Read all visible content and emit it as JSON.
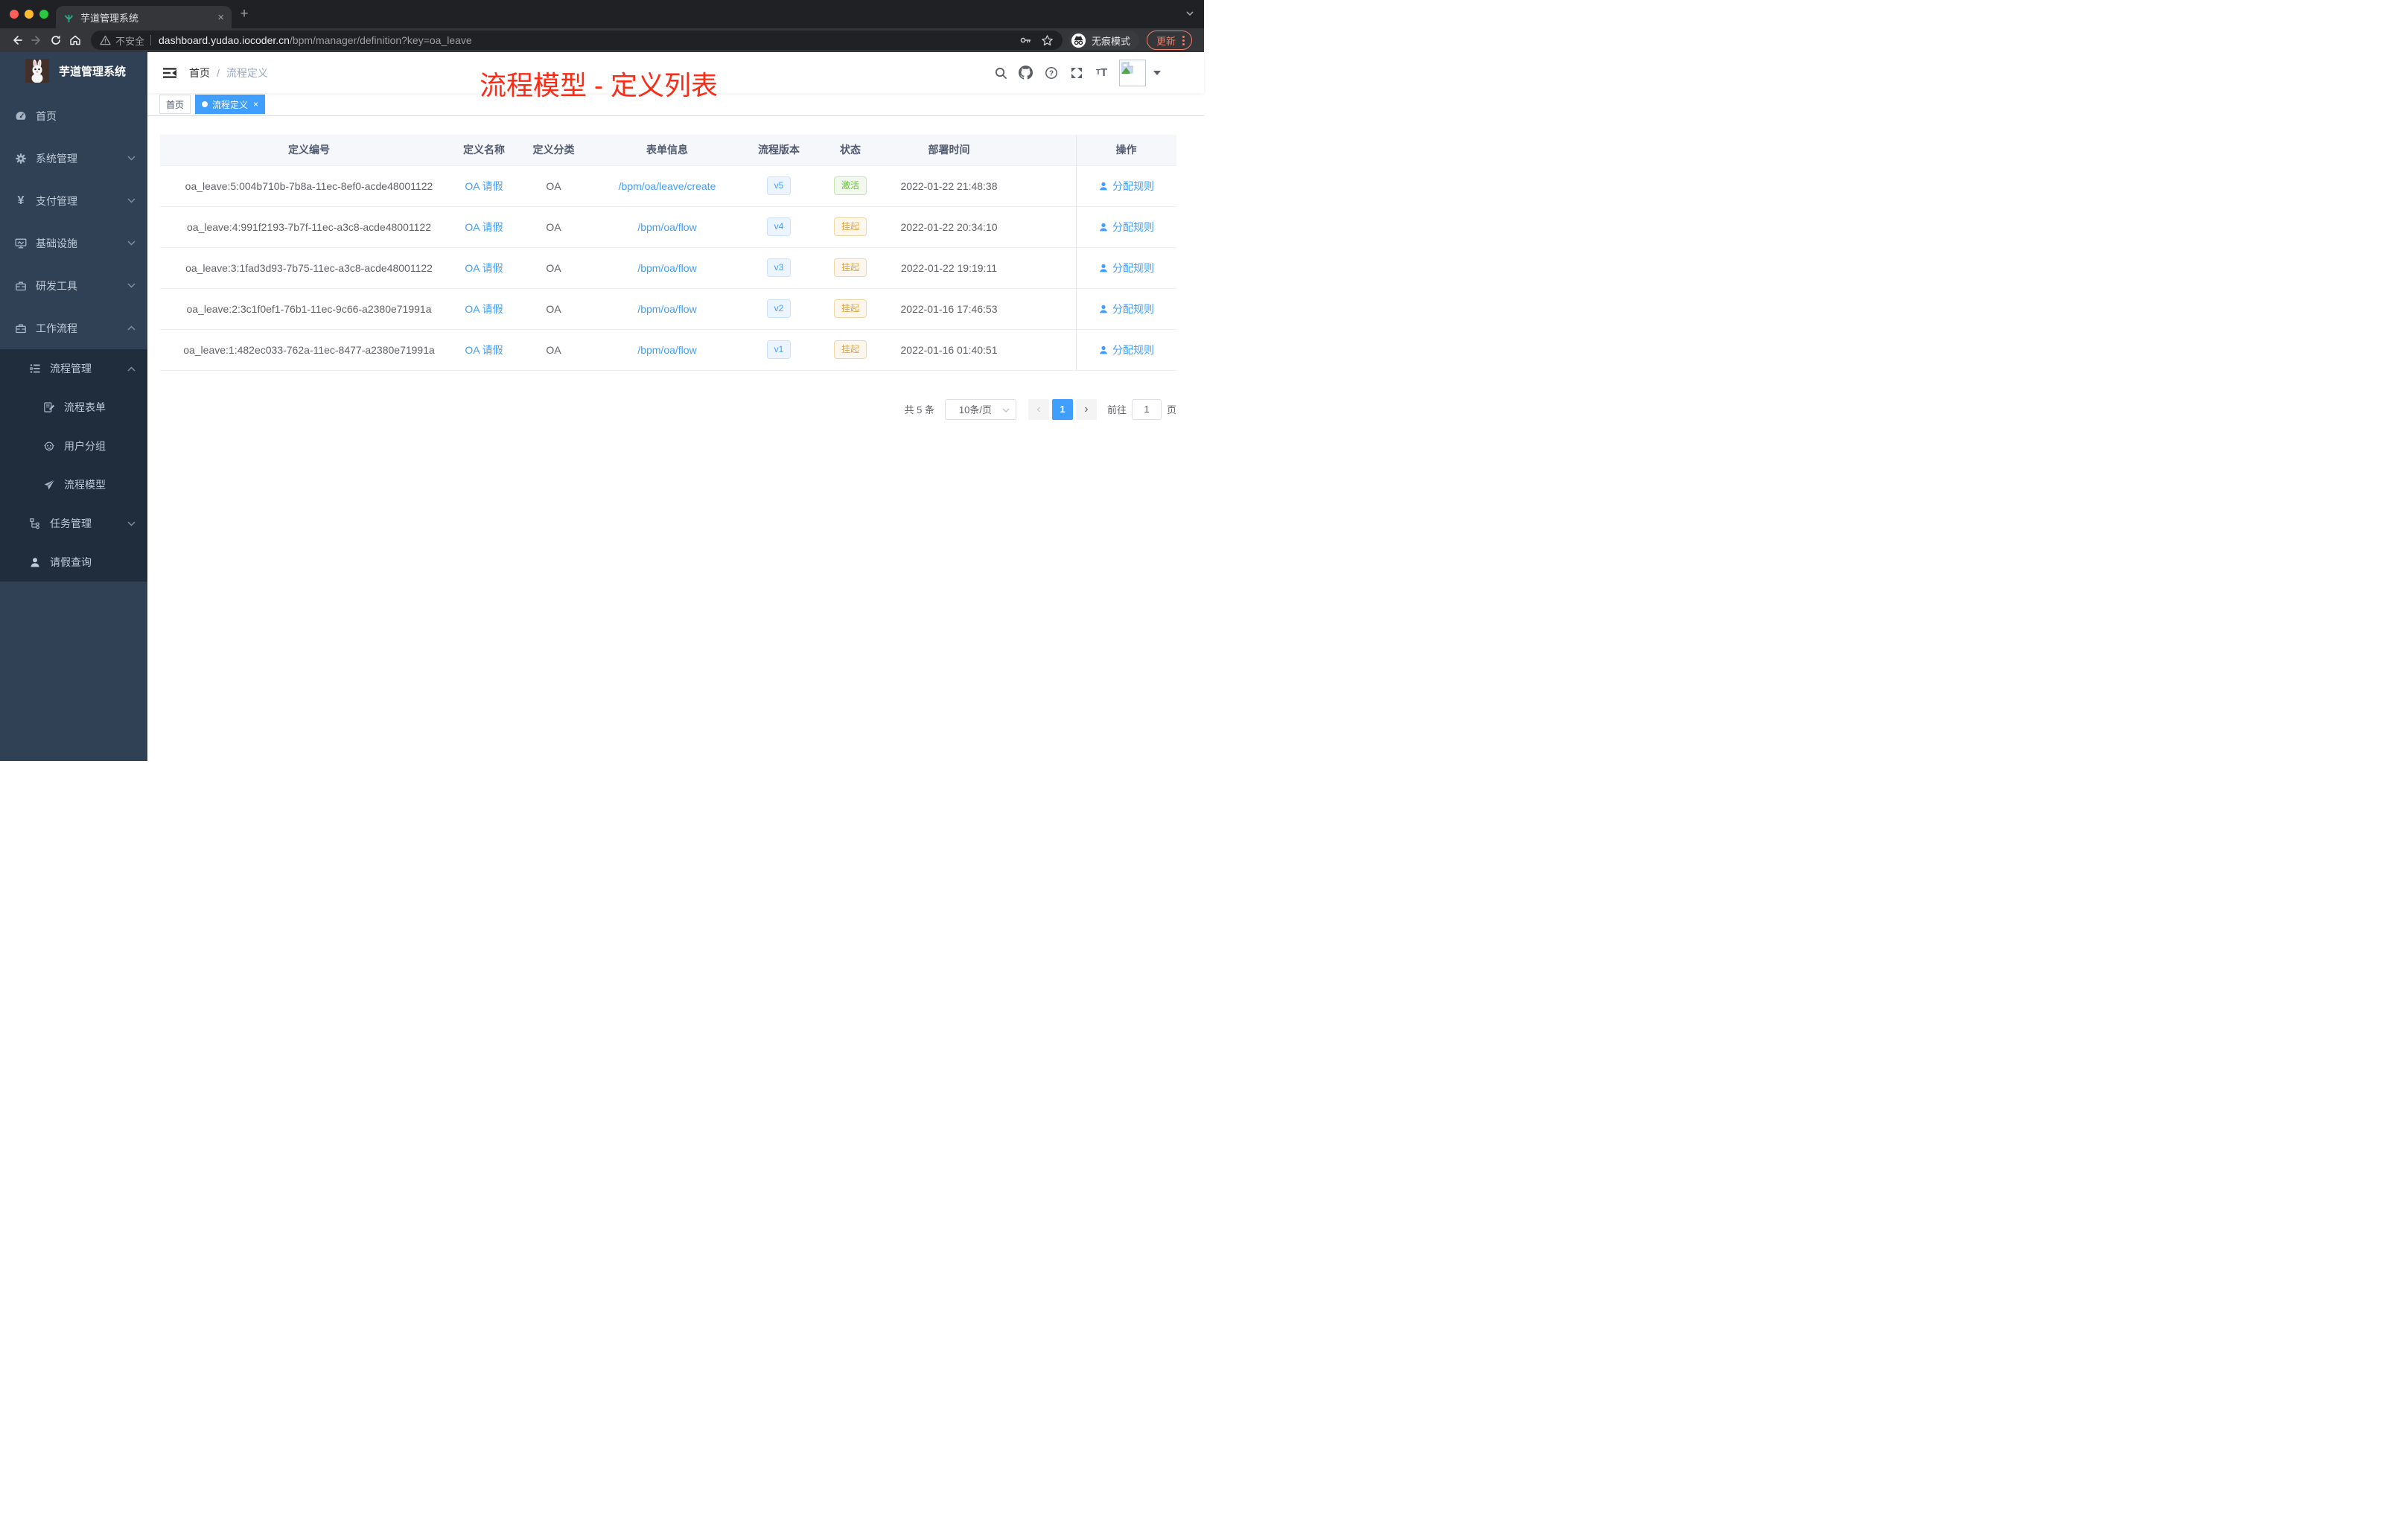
{
  "browser": {
    "tab": {
      "title": "芋道管理系统",
      "close": "×",
      "new_tab": "+"
    },
    "toolbar": {
      "security_label": "不安全",
      "url_host": "dashboard.yudao.iocoder.cn",
      "url_path": "/bpm/manager/definition?key=oa_leave",
      "incognito_label": "无痕模式",
      "update_label": "更新"
    }
  },
  "sidebar": {
    "logo_title": "芋道管理系统",
    "items": [
      {
        "label": "首页"
      },
      {
        "label": "系统管理"
      },
      {
        "label": "支付管理"
      },
      {
        "label": "基础设施"
      },
      {
        "label": "研发工具"
      },
      {
        "label": "工作流程"
      }
    ],
    "sub_items": [
      {
        "label": "流程管理"
      },
      {
        "label": "流程表单"
      },
      {
        "label": "用户分组"
      },
      {
        "label": "流程模型"
      },
      {
        "label": "任务管理"
      },
      {
        "label": "请假查询"
      }
    ]
  },
  "navbar": {
    "breadcrumb": {
      "home": "首页",
      "separator": "/",
      "current": "流程定义"
    },
    "annotation": "流程模型 - 定义列表"
  },
  "tags": {
    "home": "首页",
    "active": "流程定义",
    "close": "×"
  },
  "table": {
    "headers": [
      "定义编号",
      "定义名称",
      "定义分类",
      "表单信息",
      "流程版本",
      "状态",
      "部署时间",
      "操作"
    ],
    "action_label": "分配规则",
    "rows": [
      {
        "id": "oa_leave:5:004b710b-7b8a-11ec-8ef0-acde48001122",
        "name": "OA 请假",
        "category": "OA",
        "form": "/bpm/oa/leave/create",
        "version": "v5",
        "status": "激活",
        "time": "2022-01-22 21:48:38"
      },
      {
        "id": "oa_leave:4:991f2193-7b7f-11ec-a3c8-acde48001122",
        "name": "OA 请假",
        "category": "OA",
        "form": "/bpm/oa/flow",
        "version": "v4",
        "status": "挂起",
        "time": "2022-01-22 20:34:10"
      },
      {
        "id": "oa_leave:3:1fad3d93-7b75-11ec-a3c8-acde48001122",
        "name": "OA 请假",
        "category": "OA",
        "form": "/bpm/oa/flow",
        "version": "v3",
        "status": "挂起",
        "time": "2022-01-22 19:19:11"
      },
      {
        "id": "oa_leave:2:3c1f0ef1-76b1-11ec-9c66-a2380e71991a",
        "name": "OA 请假",
        "category": "OA",
        "form": "/bpm/oa/flow",
        "version": "v2",
        "status": "挂起",
        "time": "2022-01-16 17:46:53"
      },
      {
        "id": "oa_leave:1:482ec033-762a-11ec-8477-a2380e71991a",
        "name": "OA 请假",
        "category": "OA",
        "form": "/bpm/oa/flow",
        "version": "v1",
        "status": "挂起",
        "time": "2022-01-16 01:40:51"
      }
    ]
  },
  "pagination": {
    "total": "共 5 条",
    "page_size": "10条/页",
    "page": "1",
    "goto_label": "前往",
    "goto_value": "1",
    "unit": "页"
  },
  "colors": {
    "primary": "#409eff",
    "success": "#67c23a",
    "warning": "#e6a23c",
    "annotation_red": "#fb2b16",
    "sidebar": "#304156",
    "sidebar_sub": "#1f2d3d",
    "update_pill": "#ee7e67"
  }
}
